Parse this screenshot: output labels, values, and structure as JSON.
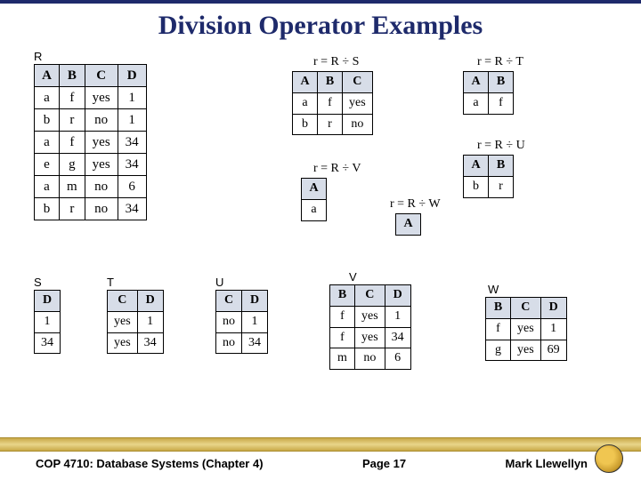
{
  "title": "Division Operator Examples",
  "labels": {
    "R": "R",
    "S": "S",
    "T": "T",
    "U": "U",
    "V": "V",
    "W": "W"
  },
  "formulas": {
    "rs": "r = R ÷ S",
    "rt": "r = R ÷ T",
    "ru": "r = R ÷ U",
    "rv": "r = R ÷ V",
    "rw": "r = R ÷ W"
  },
  "tables": {
    "R": {
      "headers": [
        "A",
        "B",
        "C",
        "D"
      ],
      "rows": [
        [
          "a",
          "f",
          "yes",
          "1"
        ],
        [
          "b",
          "r",
          "no",
          "1"
        ],
        [
          "a",
          "f",
          "yes",
          "34"
        ],
        [
          "e",
          "g",
          "yes",
          "34"
        ],
        [
          "a",
          "m",
          "no",
          "6"
        ],
        [
          "b",
          "r",
          "no",
          "34"
        ]
      ]
    },
    "rs": {
      "headers": [
        "A",
        "B",
        "C"
      ],
      "rows": [
        [
          "a",
          "f",
          "yes"
        ],
        [
          "b",
          "r",
          "no"
        ]
      ]
    },
    "rt": {
      "headers": [
        "A",
        "B"
      ],
      "rows": [
        [
          "a",
          "f"
        ]
      ]
    },
    "ru": {
      "headers": [
        "A",
        "B"
      ],
      "rows": [
        [
          "b",
          "r"
        ]
      ]
    },
    "rv": {
      "headers": [
        "A"
      ],
      "rows": [
        [
          "a"
        ]
      ]
    },
    "rw": {
      "headers": [
        "A"
      ],
      "rows": []
    },
    "S": {
      "headers": [
        "D"
      ],
      "rows": [
        [
          "1"
        ],
        [
          "34"
        ]
      ]
    },
    "T": {
      "headers": [
        "C",
        "D"
      ],
      "rows": [
        [
          "yes",
          "1"
        ],
        [
          "yes",
          "34"
        ]
      ]
    },
    "U": {
      "headers": [
        "C",
        "D"
      ],
      "rows": [
        [
          "no",
          "1"
        ],
        [
          "no",
          "34"
        ]
      ]
    },
    "V": {
      "headers": [
        "B",
        "C",
        "D"
      ],
      "rows": [
        [
          "f",
          "yes",
          "1"
        ],
        [
          "f",
          "yes",
          "34"
        ],
        [
          "m",
          "no",
          "6"
        ]
      ]
    },
    "W": {
      "headers": [
        "B",
        "C",
        "D"
      ],
      "rows": [
        [
          "f",
          "yes",
          "1"
        ],
        [
          "g",
          "yes",
          "69"
        ]
      ]
    }
  },
  "footer": {
    "left": "COP 4710: Database Systems  (Chapter 4)",
    "center": "Page 17",
    "right": "Mark Llewellyn"
  },
  "chart_data": {
    "type": "table",
    "title": "Division Operator Examples",
    "relations": {
      "R": [
        [
          "a",
          "f",
          "yes",
          1
        ],
        [
          "b",
          "r",
          "no",
          1
        ],
        [
          "a",
          "f",
          "yes",
          34
        ],
        [
          "e",
          "g",
          "yes",
          34
        ],
        [
          "a",
          "m",
          "no",
          6
        ],
        [
          "b",
          "r",
          "no",
          34
        ]
      ],
      "S": [
        [
          1
        ],
        [
          34
        ]
      ],
      "T": [
        [
          "yes",
          1
        ],
        [
          "yes",
          34
        ]
      ],
      "U": [
        [
          "no",
          1
        ],
        [
          "no",
          34
        ]
      ],
      "V": [
        [
          "f",
          "yes",
          1
        ],
        [
          "f",
          "yes",
          34
        ],
        [
          "m",
          "no",
          6
        ]
      ],
      "W": [
        [
          "f",
          "yes",
          1
        ],
        [
          "g",
          "yes",
          69
        ]
      ],
      "R_div_S": [
        [
          "a",
          "f",
          "yes"
        ],
        [
          "b",
          "r",
          "no"
        ]
      ],
      "R_div_T": [
        [
          "a",
          "f"
        ]
      ],
      "R_div_U": [
        [
          "b",
          "r"
        ]
      ],
      "R_div_V": [
        [
          "a"
        ]
      ],
      "R_div_W": []
    }
  }
}
